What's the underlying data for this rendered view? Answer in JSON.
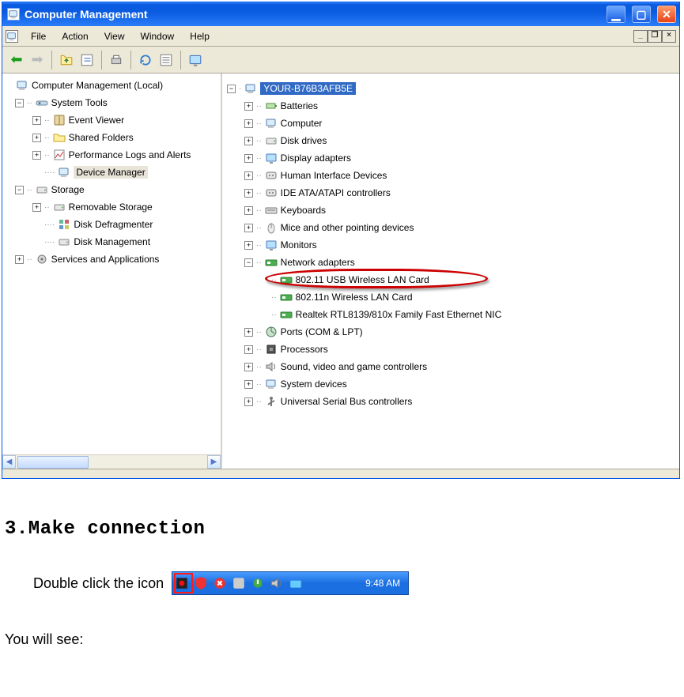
{
  "window": {
    "title": "Computer Management",
    "menu": [
      "File",
      "Action",
      "View",
      "Window",
      "Help"
    ]
  },
  "left_tree": {
    "root": "Computer Management (Local)",
    "system_tools": "System Tools",
    "event_viewer": "Event Viewer",
    "shared_folders": "Shared Folders",
    "perf_logs": "Performance Logs and Alerts",
    "device_manager": "Device Manager",
    "storage": "Storage",
    "removable_storage": "Removable Storage",
    "disk_defrag": "Disk Defragmenter",
    "disk_mgmt": "Disk Management",
    "services_apps": "Services and Applications"
  },
  "right_tree": {
    "root": "YOUR-B76B3AFB5E",
    "items": {
      "batteries": "Batteries",
      "computer": "Computer",
      "disk_drives": "Disk drives",
      "display_adapters": "Display adapters",
      "hid": "Human Interface Devices",
      "ide": "IDE ATA/ATAPI controllers",
      "keyboards": "Keyboards",
      "mice": "Mice and other pointing devices",
      "monitors": "Monitors",
      "network_adapters": "Network adapters",
      "na1": "802.11 USB Wireless LAN Card",
      "na2": "802.11n Wireless LAN Card",
      "na3": "Realtek RTL8139/810x Family Fast Ethernet NIC",
      "ports": "Ports (COM & LPT)",
      "processors": "Processors",
      "sound": "Sound, video and game controllers",
      "system_devices": "System devices",
      "usb": "Universal Serial Bus controllers"
    }
  },
  "doc": {
    "heading": "3.Make connection",
    "line1": "Double click the icon",
    "line2": "You will see:",
    "systray_time": "9:48 AM"
  }
}
